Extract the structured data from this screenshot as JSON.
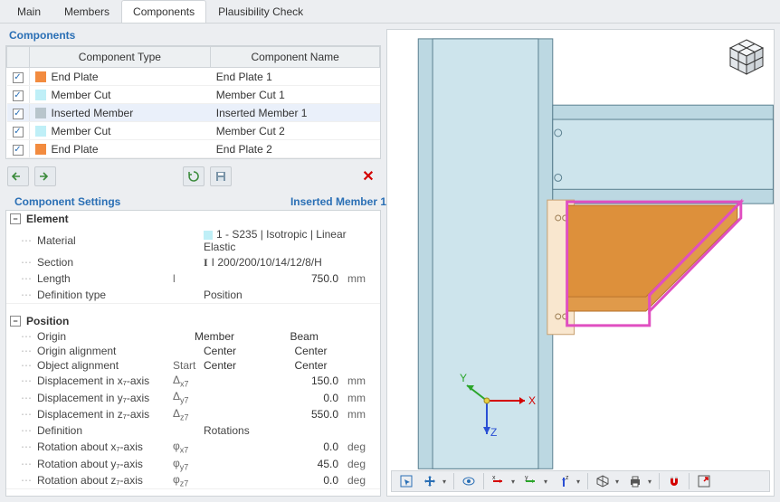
{
  "tabs": {
    "main": "Main",
    "members": "Members",
    "components": "Components",
    "plausibility": "Plausibility Check"
  },
  "components_title": "Components",
  "comp_headers": {
    "chk": "",
    "type": "Component Type",
    "name": "Component Name"
  },
  "comp_rows": [
    {
      "color": "sw-orange",
      "type": "End Plate",
      "name": "End Plate 1"
    },
    {
      "color": "sw-cyan",
      "type": "Member Cut",
      "name": "Member Cut 1"
    },
    {
      "color": "sw-gray",
      "type": "Inserted Member",
      "name": "Inserted Member 1",
      "selected": true
    },
    {
      "color": "sw-cyan",
      "type": "Member Cut",
      "name": "Member Cut 2"
    },
    {
      "color": "sw-orange",
      "type": "End Plate",
      "name": "End Plate 2"
    }
  ],
  "toolbar": {
    "delete": "✕",
    "move_up": "↥",
    "move_down": "↧"
  },
  "settings_title": "Component Settings",
  "settings_subtitle": "Inserted Member 1",
  "element": {
    "title": "Element",
    "material_lbl": "Material",
    "material_val": "1 - S235 | Isotropic | Linear Elastic",
    "section_lbl": "Section",
    "section_val": "I 200/200/10/14/12/8/H",
    "length_lbl": "Length",
    "length_sym": "l",
    "length_val": "750.0",
    "length_unit": "mm",
    "deftype_lbl": "Definition type",
    "deftype_val": "Position"
  },
  "position": {
    "title": "Position",
    "hdr_member": "Member",
    "hdr_beam": "Beam",
    "origin_lbl": "Origin",
    "origin_align_lbl": "Origin alignment",
    "origin_align_c1": "Center",
    "origin_align_c2": "Center",
    "obj_align_lbl": "Object alignment",
    "obj_align_c0": "Start",
    "obj_align_c1": "Center",
    "obj_align_c2": "Center",
    "dx_lbl": "Displacement in x₇-axis",
    "dx_sym": "Δx7",
    "dx_val": "150.0",
    "dx_unit": "mm",
    "dy_lbl": "Displacement in y₇-axis",
    "dy_sym": "Δy7",
    "dy_val": "0.0",
    "dy_unit": "mm",
    "dz_lbl": "Displacement in z₇-axis",
    "dz_sym": "Δz7",
    "dz_val": "550.0",
    "dz_unit": "mm",
    "def_lbl": "Definition",
    "def_val": "Rotations",
    "rx_lbl": "Rotation about x₇-axis",
    "rx_sym": "φx7",
    "rx_val": "0.0",
    "rx_unit": "deg",
    "ry_lbl": "Rotation about y₇-axis",
    "ry_sym": "φy7",
    "ry_val": "45.0",
    "ry_unit": "deg",
    "rz_lbl": "Rotation about z₇-axis",
    "rz_sym": "φz7",
    "rz_val": "0.0",
    "rz_unit": "deg"
  },
  "axes": {
    "x": "X",
    "y": "Y",
    "z": "Z"
  }
}
